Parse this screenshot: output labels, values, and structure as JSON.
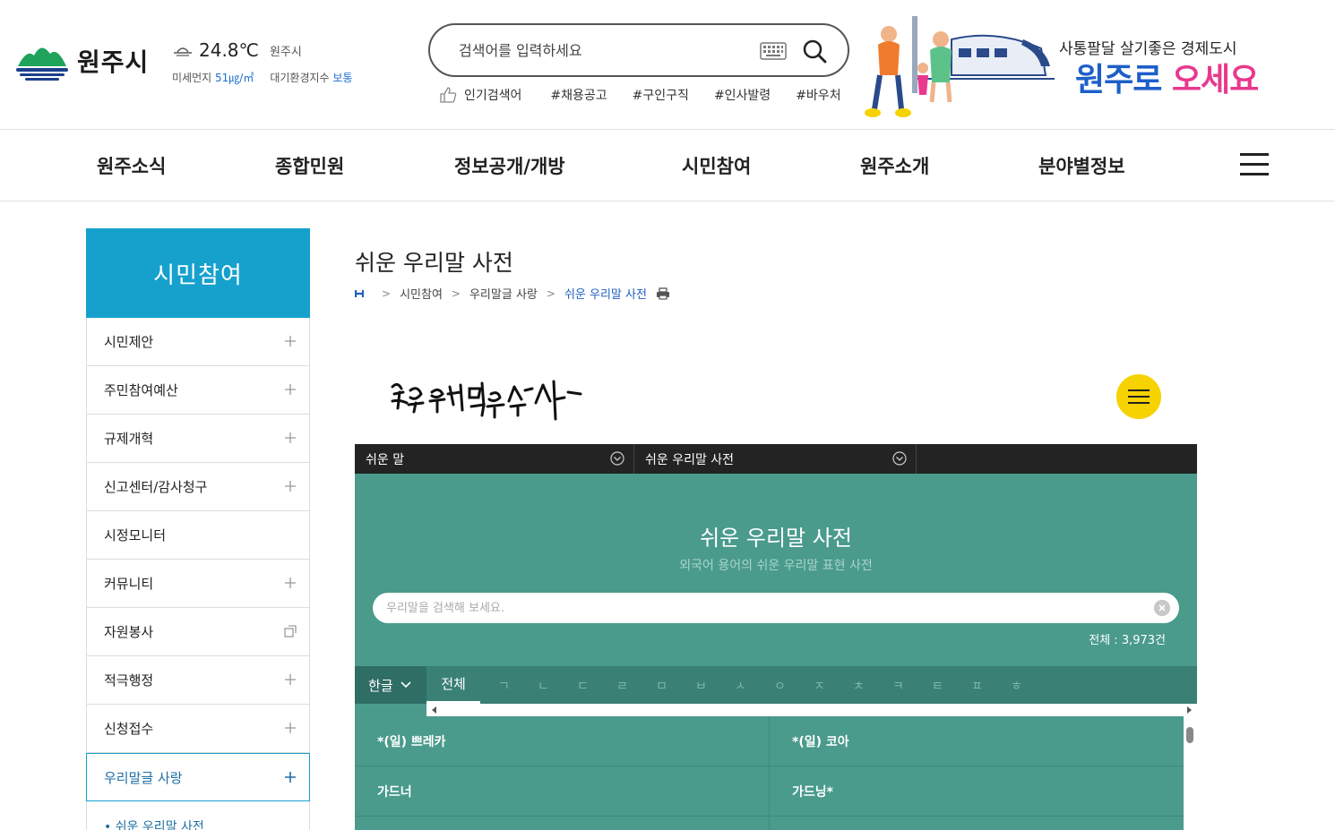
{
  "header": {
    "logo_text": "원주시",
    "weather": {
      "temperature": "24.8℃",
      "region": "원주시",
      "dust_label": "미세먼지",
      "dust_value": "51㎍/㎥",
      "aqi_label": "대기환경지수",
      "aqi_value": "보통"
    },
    "search": {
      "placeholder": "검색어를 입력하세요"
    },
    "popular": {
      "label": "인기검색어",
      "keywords": [
        "#채용공고",
        "#구인구직",
        "#인사발령",
        "#바우처"
      ]
    },
    "banner": {
      "sub": "사통팔달 살기좋은 경제도시",
      "main_1": "원주로",
      "main_2": "오세요"
    }
  },
  "gnb": {
    "items": [
      "원주소식",
      "종합민원",
      "정보공개/개방",
      "시민참여",
      "원주소개",
      "분야별정보"
    ]
  },
  "lnb": {
    "title": "시민참여",
    "items": [
      {
        "label": "시민제안",
        "icon": "plus-icon"
      },
      {
        "label": "주민참여예산",
        "icon": "plus-icon"
      },
      {
        "label": "규제개혁",
        "icon": "plus-icon"
      },
      {
        "label": "신고센터/감사청구",
        "icon": "plus-icon"
      },
      {
        "label": "시정모니터",
        "icon": ""
      },
      {
        "label": "커뮤니티",
        "icon": "plus-icon"
      },
      {
        "label": "자원봉사",
        "icon": "new-window-icon"
      },
      {
        "label": "적극행정",
        "icon": "plus-icon"
      },
      {
        "label": "신청접수",
        "icon": "plus-icon"
      },
      {
        "label": "우리말글 사랑",
        "icon": "plus-icon"
      }
    ],
    "sub_item": "쉬운 우리말 사전"
  },
  "content": {
    "title": "쉬운 우리말 사전",
    "breadcrumb": [
      "시민참여",
      "우리말글 사랑",
      "쉬운 우리말 사전"
    ],
    "dict_logo_text": "쉬운우리말을쓰자",
    "dropdowns": [
      "쉬운 말",
      "쉬운 우리말 사전"
    ],
    "dict": {
      "title": "쉬운 우리말 사전",
      "subtitle": "외국어 용어의 쉬운 우리말 표현 사전",
      "search_placeholder": "우리말을 검색해 보세요.",
      "total": "전체 : 3,973건",
      "lang": "한글",
      "tab_all": "전체",
      "consonants": [
        "ㄱ",
        "ㄴ",
        "ㄷ",
        "ㄹ",
        "ㅁ",
        "ㅂ",
        "ㅅ",
        "ㅇ",
        "ㅈ",
        "ㅊ",
        "ㅋ",
        "ㅌ",
        "ㅍ",
        "ㅎ"
      ],
      "words": [
        "*(일) 쁘레카",
        "*(일) 코아",
        "가드너",
        "가드닝*"
      ]
    }
  },
  "colors": {
    "accent": "#16a1cd",
    "teal": "#4a9b8c",
    "banner_blue": "#1d5fc8",
    "banner_pink": "#e8398e",
    "yellow": "#f6d200"
  }
}
